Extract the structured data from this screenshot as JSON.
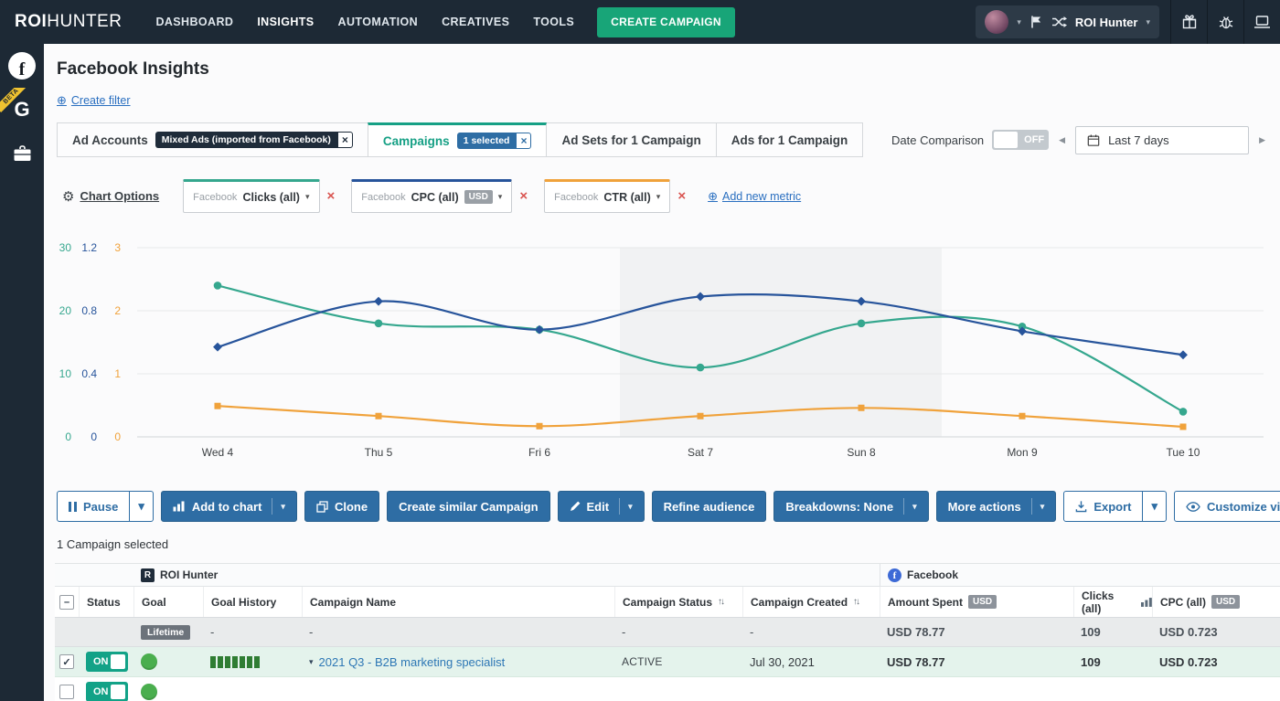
{
  "theme": {
    "navbar_bg": "#1d2935",
    "accent_green": "#18a578",
    "button_blue": "#2e6da4",
    "link_blue": "#2a6fc0",
    "selected_row_bg": "#e4f3ec"
  },
  "icons": {
    "facebook_letter": "f",
    "google_letter": "G",
    "roi_letter": "R"
  },
  "navbar": {
    "logo_bold": "ROI",
    "logo_light": "HUNTER",
    "items": [
      "DASHBOARD",
      "INSIGHTS",
      "AUTOMATION",
      "CREATIVES",
      "TOOLS"
    ],
    "active_item": "INSIGHTS",
    "create_campaign": "CREATE CAMPAIGN",
    "account_name": "ROI Hunter"
  },
  "sidebar": {
    "beta_label": "BETA"
  },
  "page": {
    "title": "Facebook Insights",
    "create_filter": "Create filter"
  },
  "tabs": [
    {
      "label": "Ad Accounts",
      "badge": "Mixed Ads (imported from Facebook)"
    },
    {
      "label": "Campaigns",
      "badge": "1 selected",
      "active": true
    },
    {
      "label": "Ad Sets for 1 Campaign"
    },
    {
      "label": "Ads for 1 Campaign"
    }
  ],
  "date_controls": {
    "comparison_label": "Date Comparison",
    "toggle_state": "OFF",
    "range": "Last 7 days"
  },
  "chart_controls": {
    "chart_options": "Chart Options",
    "add_new_metric": "Add new metric",
    "metrics": [
      {
        "prefix": "Facebook",
        "label": "Clicks (all)",
        "color": "#35a78e"
      },
      {
        "prefix": "Facebook",
        "label": "CPC (all)",
        "badge": "USD",
        "color": "#27549b"
      },
      {
        "prefix": "Facebook",
        "label": "CTR (all)",
        "color": "#f0a23b"
      }
    ]
  },
  "chart_data": {
    "type": "line",
    "x": [
      "Wed 4",
      "Thu 5",
      "Fri 6",
      "Sat 7",
      "Sun 8",
      "Mon 9",
      "Tue 10"
    ],
    "y_axes": [
      {
        "name": "Clicks (all)",
        "color": "#35a78e",
        "ticks": [
          0,
          10,
          20,
          30
        ]
      },
      {
        "name": "CPC (all) USD",
        "color": "#27549b",
        "ticks": [
          0,
          0.4,
          0.8,
          1.2
        ]
      },
      {
        "name": "CTR (all)",
        "color": "#f0a23b",
        "ticks": [
          0,
          1,
          2,
          3
        ]
      }
    ],
    "series": [
      {
        "name": "Facebook Clicks (all)",
        "color": "#35a78e",
        "marker": "circle",
        "axis_max": 30,
        "values": [
          24,
          18,
          17,
          11,
          18,
          17.5,
          4
        ]
      },
      {
        "name": "Facebook CPC (all)",
        "color": "#27549b",
        "marker": "diamond",
        "axis_max": 1.2,
        "values": [
          0.57,
          0.86,
          0.68,
          0.89,
          0.86,
          0.67,
          0.52
        ]
      },
      {
        "name": "Facebook CTR (all)",
        "color": "#f0a23b",
        "marker": "square",
        "axis_max": 3,
        "values": [
          0.49,
          0.33,
          0.17,
          0.33,
          0.46,
          0.33,
          0.16
        ]
      }
    ],
    "weekend_band": [
      "Sat 7",
      "Sun 8"
    ],
    "grid": true,
    "legend": "none"
  },
  "actions": {
    "pause": "Pause",
    "add_to_chart": "Add to chart",
    "clone": "Clone",
    "create_similar": "Create similar Campaign",
    "edit": "Edit",
    "refine_audience": "Refine audience",
    "breakdowns": "Breakdowns: None",
    "more_actions": "More actions",
    "export": "Export",
    "customize_view": "Customize view"
  },
  "selection_text": "1 Campaign selected",
  "table": {
    "group_left": "ROI Hunter",
    "group_right": "Facebook",
    "columns": {
      "status": "Status",
      "goal": "Goal",
      "goal_history": "Goal History",
      "campaign_name": "Campaign Name",
      "campaign_status": "Campaign Status",
      "campaign_created": "Campaign Created",
      "amount_spent": "Amount Spent",
      "clicks": "Clicks (all)",
      "cpc": "CPC (all)"
    },
    "usd_badge": "USD",
    "summary_row": {
      "badge": "Lifetime",
      "goal_history": "-",
      "campaign_name": "-",
      "campaign_status": "-",
      "campaign_created": "-",
      "amount_spent": "USD 78.77",
      "clicks": "109",
      "cpc": "USD 0.723"
    },
    "rows": [
      {
        "toggle": "ON",
        "campaign_name": "2021 Q3 - B2B marketing specialist",
        "campaign_status": "ACTIVE",
        "campaign_created": "Jul 30, 2021",
        "amount_spent": "USD 78.77",
        "clicks": "109",
        "cpc": "USD 0.723"
      }
    ],
    "partial_row_toggle": "ON"
  }
}
